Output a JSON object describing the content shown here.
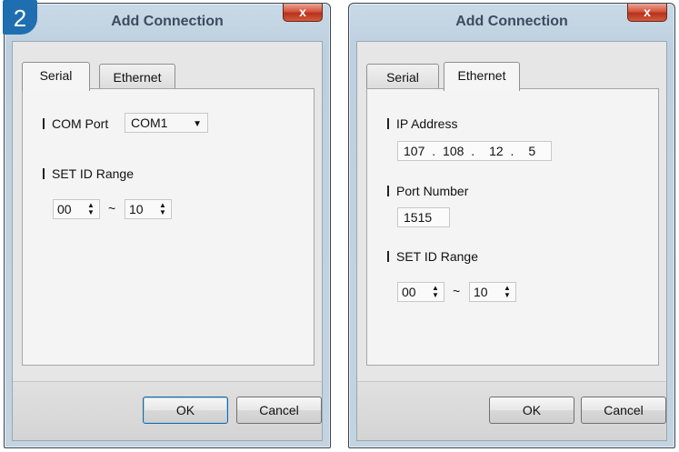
{
  "step_badge": "2",
  "dialog_left": {
    "title": "Add Connection",
    "close": "x",
    "tabs": [
      "Serial",
      "Ethernet"
    ],
    "active_tab": "Serial",
    "com_port": {
      "label": "COM Port",
      "value": "COM1"
    },
    "set_id_range": {
      "label": "SET ID Range",
      "from": "00",
      "separator": "~",
      "to": "10"
    },
    "ok_label": "OK",
    "cancel_label": "Cancel"
  },
  "dialog_right": {
    "title": "Add Connection",
    "close": "x",
    "tabs": [
      "Serial",
      "Ethernet"
    ],
    "active_tab": "Ethernet",
    "ip_address": {
      "label": "IP Address",
      "octets": [
        "107",
        "108",
        "12",
        "5"
      ],
      "dot": "."
    },
    "port_number": {
      "label": "Port Number",
      "value": "1515"
    },
    "set_id_range": {
      "label": "SET ID Range",
      "from": "00",
      "separator": "~",
      "to": "10"
    },
    "ok_label": "OK",
    "cancel_label": "Cancel"
  },
  "icons": {
    "combo_arrow": "triangle-down",
    "spinner": "up-down-arrows"
  }
}
